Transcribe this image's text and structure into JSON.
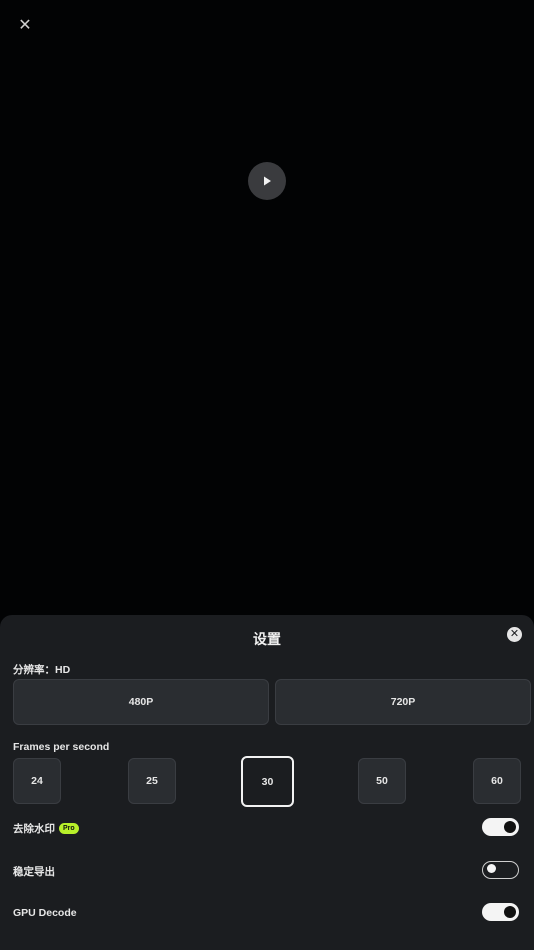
{
  "preview": {
    "close_icon": "close-icon",
    "play_icon": "play-icon"
  },
  "sheet": {
    "title": "设置",
    "close_icon": "close-icon",
    "resolution": {
      "label": "分辨率：HD",
      "options": [
        "480P",
        "720P"
      ]
    },
    "fps": {
      "label": "Frames per second",
      "options": [
        "24",
        "25",
        "30",
        "50",
        "60"
      ],
      "selected": "30"
    },
    "watermark": {
      "label": "去除水印",
      "badge": "Pro",
      "enabled": true
    },
    "stabilize": {
      "label": "稳定导出",
      "enabled": false
    },
    "gpu_decode": {
      "label": "GPU Decode",
      "enabled": true
    }
  },
  "colors": {
    "background": "#020304",
    "sheet": "#1b1d20",
    "button": "#2a2d31",
    "pro_badge": "#b8f02a"
  }
}
